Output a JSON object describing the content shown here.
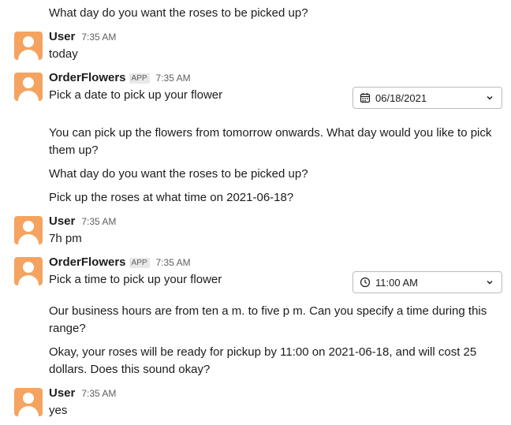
{
  "messages": {
    "prompt_1": "What day do you want the roses to be picked up?",
    "user_1": {
      "name": "User",
      "time": "7:35 AM",
      "text": "today"
    },
    "bot_1": {
      "name": "OrderFlowers",
      "badge": "APP",
      "time": "7:35 AM",
      "text": "Pick a date to pick up your flower",
      "picker_value": "06/18/2021",
      "picker_icon": "calendar-icon",
      "follow_1": "You can pick up the flowers from tomorrow onwards.  What day would you like to pick them up?",
      "follow_2": "What day do you want the roses to be picked up?",
      "follow_3": "Pick up the roses at what time on 2021-06-18?"
    },
    "user_2": {
      "name": "User",
      "time": "7:35 AM",
      "text": "7h pm"
    },
    "bot_2": {
      "name": "OrderFlowers",
      "badge": "APP",
      "time": "7:35 AM",
      "text": "Pick a time to pick up your flower",
      "picker_value": "11:00 AM",
      "picker_icon": "clock-icon",
      "follow_1": "Our business hours are from ten a m. to five p m. Can you specify a time during this range?",
      "follow_2": "Okay, your roses will be ready for pickup by 11:00 on 2021-06-18, and will cost 25 dollars.  Does this sound okay?"
    },
    "user_3": {
      "name": "User",
      "time": "7:35 AM",
      "text": "yes"
    }
  },
  "colors": {
    "avatar": "#f4a460",
    "text": "#1d1c1d",
    "muted": "#616061"
  }
}
